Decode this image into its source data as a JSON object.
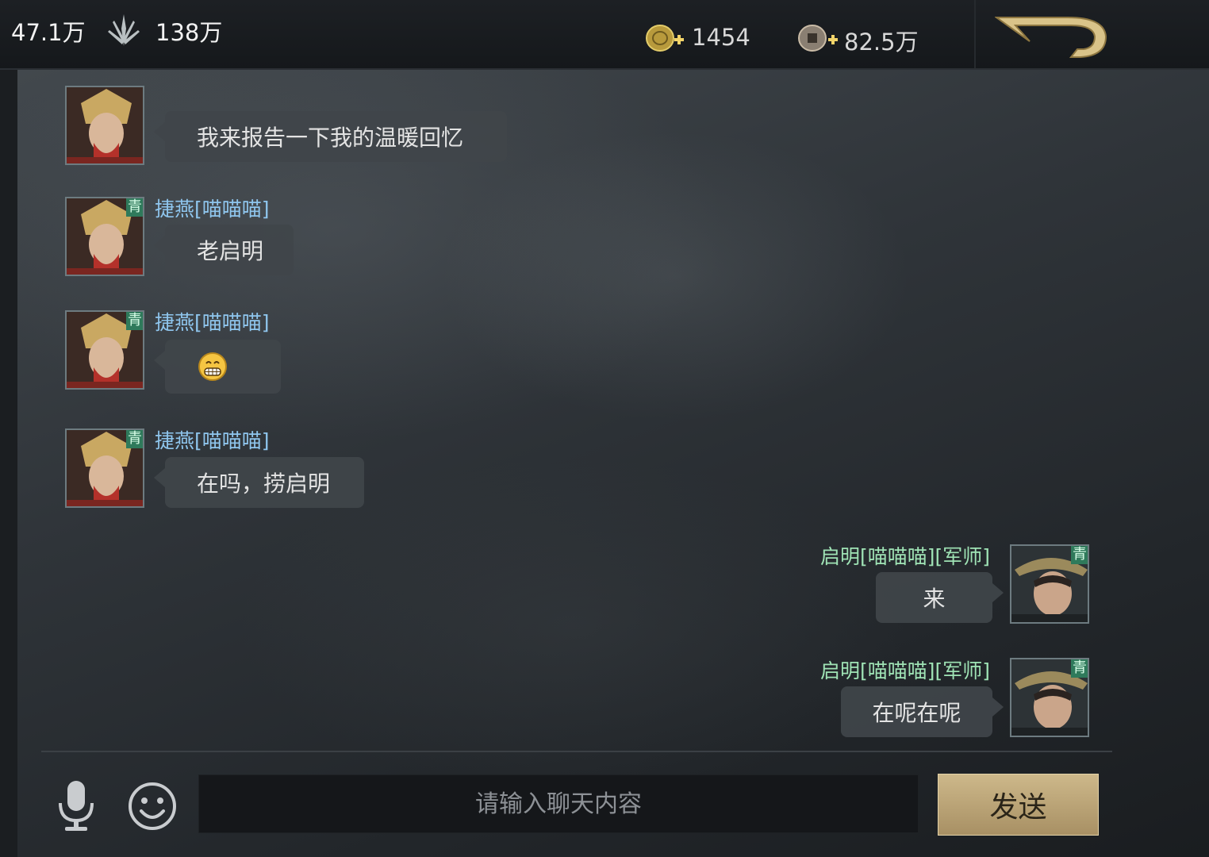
{
  "topbar": {
    "power": "47.1万",
    "troops": "138万",
    "gold": "1454",
    "coins": "82.5万"
  },
  "messages": [
    {
      "side": "left",
      "sender": "",
      "text": "我来报告一下我的温暖回忆"
    },
    {
      "side": "left",
      "sender": "捷燕[喵喵喵]",
      "rank": "青",
      "text": "老启明"
    },
    {
      "side": "left",
      "sender": "捷燕[喵喵喵]",
      "rank": "青",
      "text": "😁"
    },
    {
      "side": "left",
      "sender": "捷燕[喵喵喵]",
      "rank": "青",
      "text": "在吗，捞启明"
    },
    {
      "side": "right",
      "sender": "启明[喵喵喵][军师]",
      "rank": "青",
      "text": "来"
    },
    {
      "side": "right",
      "sender": "启明[喵喵喵][军师]",
      "rank": "青",
      "text": "在呢在呢"
    }
  ],
  "input": {
    "placeholder": "请输入聊天内容",
    "send_label": "发送"
  },
  "colors": {
    "sender_left": "#8fc6ee",
    "sender_right": "#9fe3b5",
    "rank_badge": "#2f7a5b",
    "send_button": "#c2ac7c"
  },
  "icons": [
    "troops-icon",
    "gold-icon",
    "coin-icon",
    "back-icon",
    "mic-icon",
    "emoji-icon"
  ]
}
